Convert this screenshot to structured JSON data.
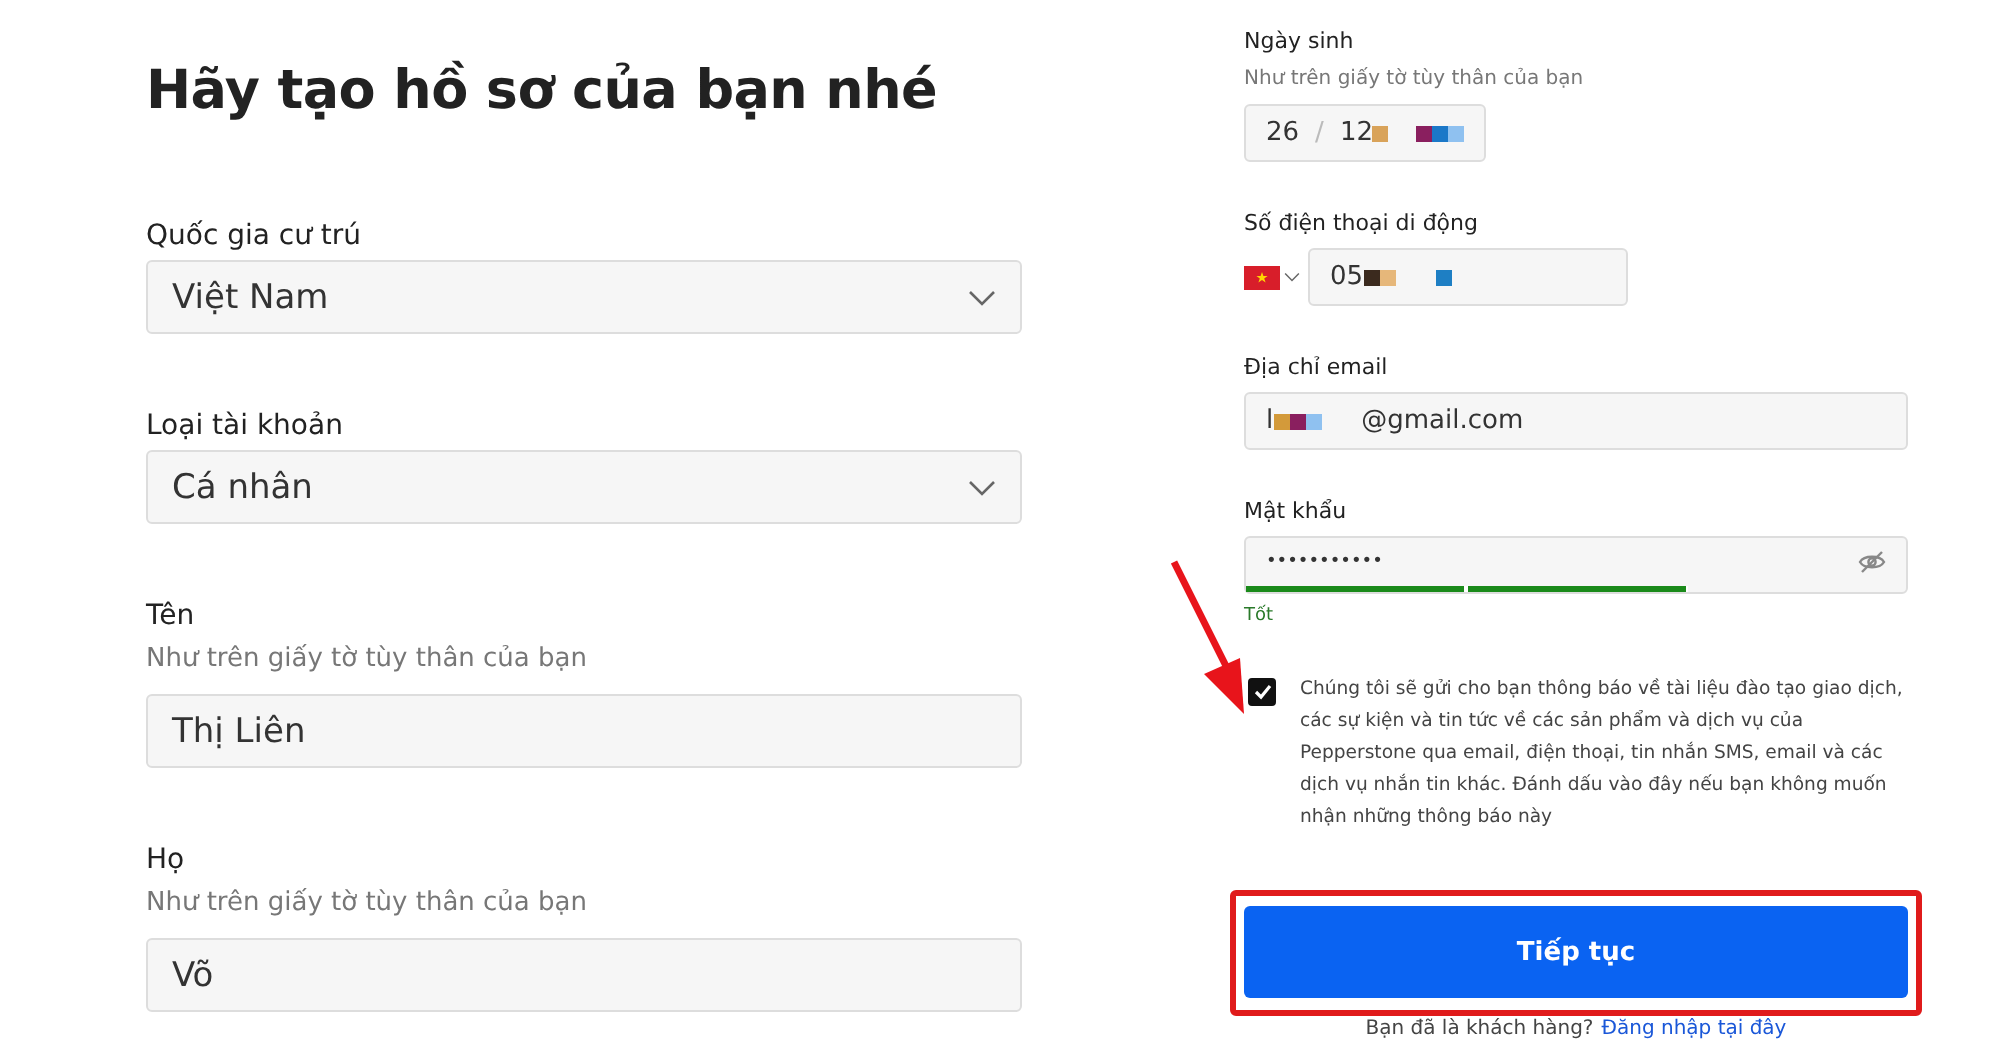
{
  "title": "Hãy tạo hồ sơ của bạn nhé",
  "left_fields": [
    {
      "kind": "select",
      "label": "Quốc gia cư trú",
      "value": "Việt Nam"
    },
    {
      "kind": "select",
      "label": "Loại tài khoản",
      "value": "Cá nhân"
    },
    {
      "kind": "text",
      "label": "Tên",
      "hint": "Như trên giấy tờ tùy thân của bạn",
      "value": "Thị Liên"
    },
    {
      "kind": "text",
      "label": "Họ",
      "hint": "Như trên giấy tờ tùy thân của bạn",
      "value": "Võ"
    }
  ],
  "birth_date": {
    "label": "Ngày sinh",
    "hint": "Như trên giấy tờ tùy thân của bạn",
    "day": "26",
    "separator": "/",
    "month": "12"
  },
  "phone": {
    "label": "Số điện thoại di động",
    "value": "05"
  },
  "email": {
    "label": "Địa chỉ email",
    "value_start": "l",
    "value_end": "@gmail.com"
  },
  "password": {
    "label": "Mật khẩu",
    "value": "•••••••••••",
    "strength": {
      "level": 0.67,
      "text": "Tốt"
    }
  },
  "marketing_opt_out": {
    "checked": true,
    "text": "Chúng tôi sẽ gửi cho bạn thông báo về tài liệu đào tạo giao dịch, các sự kiện và tin tức về các sản phẩm và dịch vụ của Pepperstone qua email, điện thoại, tin nhắn SMS, email và các dịch vụ nhắn tin khác. Đánh dấu vào đây nếu bạn không muốn nhận những thông báo này"
  },
  "continue_button": "Tiếp tục",
  "login_prompt": {
    "text": "Bạn đã là khách hàng?",
    "link": "Đăng nhập tại đây"
  },
  "annotations": {
    "arrow": true,
    "highlight_frame": true
  }
}
